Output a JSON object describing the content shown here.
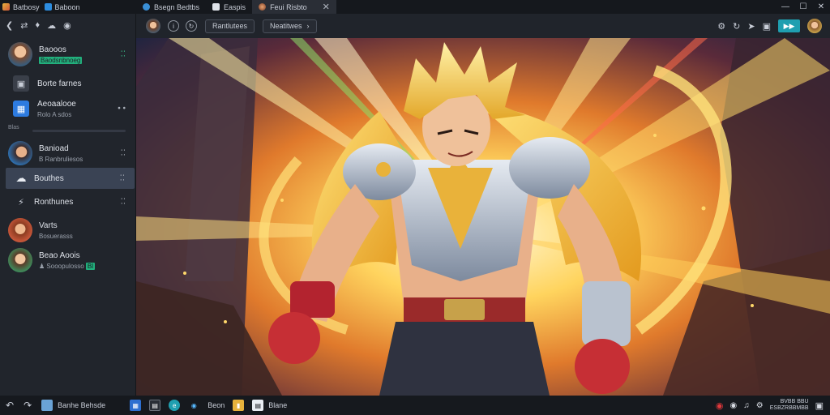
{
  "window": {
    "app_name": "Batbosy",
    "app2_name": "Baboon",
    "tabs": [
      {
        "label": "Bsegn Bedtbs"
      },
      {
        "label": "Easpis"
      },
      {
        "label": "Feui Risbto",
        "close": "✕"
      }
    ]
  },
  "sidebar": {
    "items": [
      {
        "title": "Baooos",
        "sub": "Baodsnbnoeg",
        "more": "⁚⁚"
      },
      {
        "title": "Borte farnes"
      },
      {
        "title": "Aeoaalooe",
        "sub": "Rolo A sdos",
        "more": "• •"
      }
    ],
    "divider_label": "Blas",
    "items2": [
      {
        "title": "Banioad",
        "sub": "B Ranbruliesos",
        "more": "⁚⁚"
      },
      {
        "title": "Bouthes",
        "more": "⁚⁚"
      },
      {
        "title": "Ronthunes",
        "more": "⁚⁚"
      },
      {
        "title": "Varts",
        "sub": "Bosuerasss"
      },
      {
        "title": "Beao Aoois",
        "sub": "Sooopulosso",
        "badge": "Bl"
      }
    ]
  },
  "toolrow": {
    "field1": "Rantlutees",
    "field2": "Neatitwes"
  },
  "taskbar": {
    "app_label": "Banhe Behsde",
    "item1": "Beon",
    "item2": "Blane",
    "clock_line1": "BVBB BBU",
    "clock_line2": "ESBZRBBMBB"
  },
  "colors": {
    "accent": "#1f9fb0",
    "sidebar_bg": "#21252c",
    "active_item": "#3a4354",
    "badge_green": "#22b07d"
  }
}
